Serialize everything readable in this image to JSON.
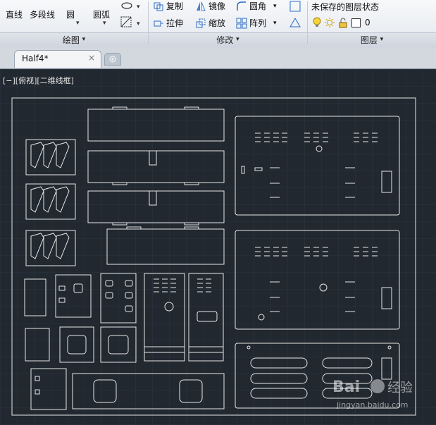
{
  "ribbon": {
    "draw": {
      "line": "直线",
      "polyline": "多段线",
      "circle": "圆",
      "arc": "圆弧",
      "title": "绘图"
    },
    "modify": {
      "copy": "复制",
      "mirror": "镜像",
      "fillet": "圆角",
      "stretch": "拉伸",
      "scale": "缩放",
      "array": "阵列",
      "title": "修改"
    },
    "layers": {
      "state": "未保存的图层状态",
      "current": "0",
      "title": "图层"
    }
  },
  "tabs": {
    "doc": "Half4*",
    "close": "×"
  },
  "viewport": {
    "label": "[−][俯视][二维线框]"
  },
  "colors": {
    "canvas_bg": "#212830",
    "line": "#e8e8e8"
  }
}
